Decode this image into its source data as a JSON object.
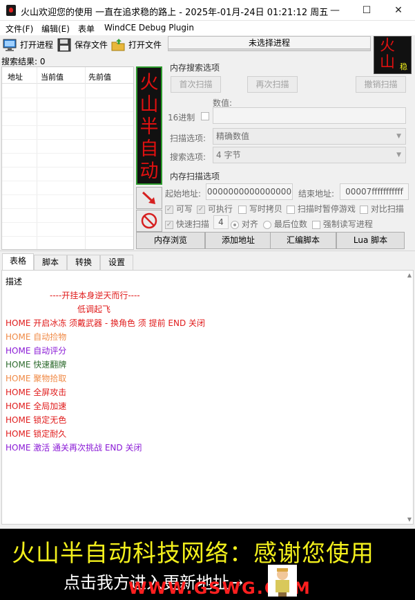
{
  "window": {
    "title": "火山欢迎您的使用 一直在追求稳的路上  - 2025年-01月-24日 01:21:12 周五",
    "controls": {
      "minimize": "—",
      "maximize": "☐",
      "close": "✕"
    }
  },
  "menu": [
    "文件(F)",
    "编辑(E)",
    "表单",
    "WindCE Debug Plugin"
  ],
  "toolbar": {
    "open_process": "打开进程",
    "save_file": "保存文件",
    "open_file": "打开文件",
    "process_status": "未选择进程",
    "logo_text": "火山",
    "logo_sub": "稳"
  },
  "results": {
    "label": "搜索结果: 0",
    "columns": [
      "地址",
      "当前值",
      "先前值"
    ]
  },
  "sign": {
    "text": "火山半自动"
  },
  "memory_search": {
    "title": "内存搜索选项",
    "first_scan": "首次扫描",
    "next_scan": "再次扫描",
    "undo_scan": "撤销扫描",
    "value_label": "数值:",
    "hex_label": "16进制",
    "scan_option_label": "扫描选项:",
    "scan_option_value": "精确数值",
    "search_option_label": "搜索选项:",
    "search_option_value": "4 字节"
  },
  "memory_scan": {
    "title": "内存扫描选项",
    "start_label": "起始地址:",
    "start_value": "0000000000000000",
    "end_label": "结束地址:",
    "end_value": "00007fffffffffff",
    "writable": "可写",
    "executable": "可执行",
    "copy_on_write": "写时拷贝",
    "pause_game": "扫描时暂停游戏",
    "compare_scan": "对比扫描",
    "fast_scan": "快速扫描",
    "fast_scan_value": "4",
    "align": "对齐",
    "last_digits": "最后位数",
    "force_rw": "强制读写进程"
  },
  "actions": {
    "memory_view": "内存浏览",
    "add_address": "添加地址",
    "assemble": "汇编脚本",
    "lua": "Lua 脚本"
  },
  "tabs": [
    "表格",
    "脚本",
    "转换",
    "设置"
  ],
  "table": {
    "header": "描述",
    "lines": [
      {
        "text": "----开挂本身逆天而行----",
        "color": "#e01b1b"
      },
      {
        "text": "低调起飞",
        "color": "#e01b1b"
      },
      {
        "text": "HOME 开启冰冻 须戴武器 - 换角色 须 提前 END 关闭",
        "color": "#e01b1b"
      },
      {
        "text": "HOME  自动捡物",
        "color": "#f08a46"
      },
      {
        "text": "HOME  自动评分",
        "color": "#8a1ad6"
      },
      {
        "text": "HOME  快速翻牌",
        "color": "#2e6b2e"
      },
      {
        "text": "HOME  聚物拾取",
        "color": "#f08a46"
      },
      {
        "text": "HOME  全屏攻击",
        "color": "#e01b1b"
      },
      {
        "text": "HOME  全局加速",
        "color": "#e01b1b"
      },
      {
        "text": "HOME  锁定无色",
        "color": "#e01b1b"
      },
      {
        "text": "HOME  锁定耐久",
        "color": "#e01b1b"
      },
      {
        "text": "HOME  激活  通关再次挑战    END 关闭",
        "color": "#8a1ad6"
      }
    ]
  },
  "banner": {
    "line1": "火山半自动科技网络：感谢您使用",
    "line2": "点击我方进入更新地址→",
    "watermark": "WWW.GSWG.COM"
  }
}
